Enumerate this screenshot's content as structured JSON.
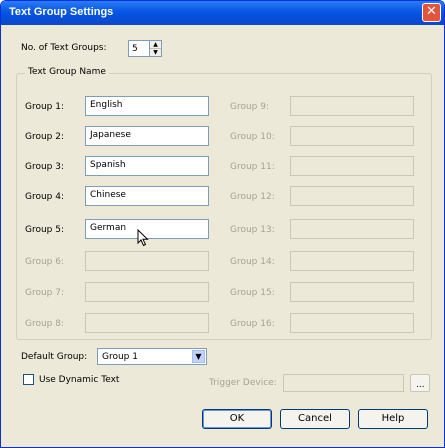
{
  "window": {
    "title": "Text Group Settings"
  },
  "num_groups": {
    "label": "No. of Text Groups:",
    "value": "5"
  },
  "group_box": {
    "title": "Text Group Name"
  },
  "groups": [
    {
      "label": "Group 1:",
      "value": "English"
    },
    {
      "label": "Group 2:",
      "value": "Japanese"
    },
    {
      "label": "Group 3:",
      "value": "Spanish"
    },
    {
      "label": "Group 4:",
      "value": "Chinese"
    },
    {
      "label": "Group 5:",
      "value": "German"
    },
    {
      "label": "Group 6:",
      "value": ""
    },
    {
      "label": "Group 7:",
      "value": ""
    },
    {
      "label": "Group 8:",
      "value": ""
    },
    {
      "label": "Group 9:",
      "value": ""
    },
    {
      "label": "Group 10:",
      "value": ""
    },
    {
      "label": "Group 11:",
      "value": ""
    },
    {
      "label": "Group 12:",
      "value": ""
    },
    {
      "label": "Group 13:",
      "value": ""
    },
    {
      "label": "Group 14:",
      "value": ""
    },
    {
      "label": "Group 15:",
      "value": ""
    },
    {
      "label": "Group 16:",
      "value": ""
    }
  ],
  "default_group": {
    "label": "Default Group:",
    "value": "Group 1"
  },
  "dynamic_text": {
    "label": "Use Dynamic Text",
    "checked": false
  },
  "trigger": {
    "label": "Trigger Device:",
    "value": "",
    "browse": "..."
  },
  "buttons": {
    "ok": "OK",
    "cancel": "Cancel",
    "help": "Help"
  }
}
